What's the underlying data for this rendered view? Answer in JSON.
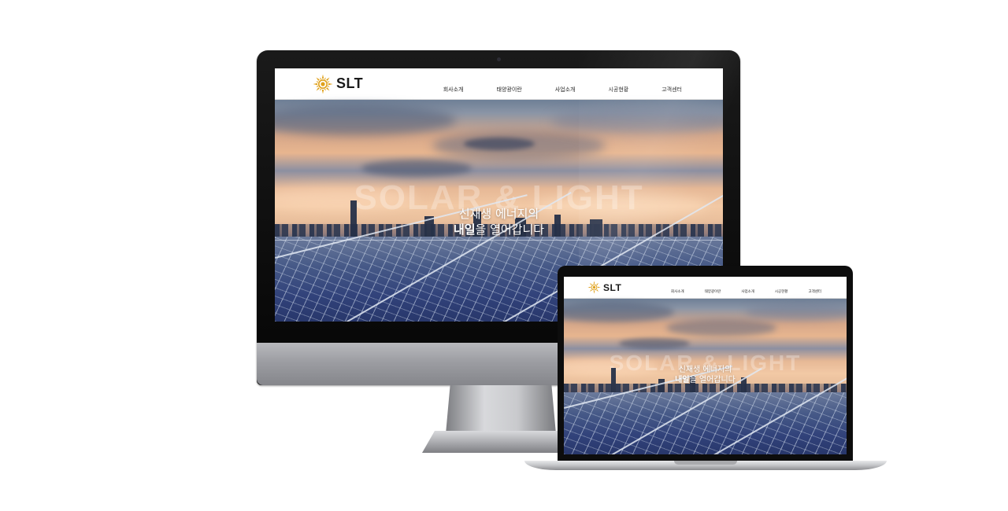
{
  "site": {
    "logo_text": "SLT",
    "nav": [
      "회사소개",
      "태양광이란",
      "사업소개",
      "시공현황",
      "고객센터"
    ],
    "hero_watermark": "SOLAR & LIGHT",
    "tagline_line1": "신재생 에너지의",
    "tagline_line2_bold": "내일",
    "tagline_line2_rest": "을 열어갑니다"
  },
  "colors": {
    "header_bg": "#ffffff",
    "sun_logo": "#e0a11b",
    "device_bezel": "#0d0d0d",
    "device_silver": "#b8b9bd"
  },
  "icons": {
    "logo": "sun-icon",
    "camera": "camera-icon"
  }
}
